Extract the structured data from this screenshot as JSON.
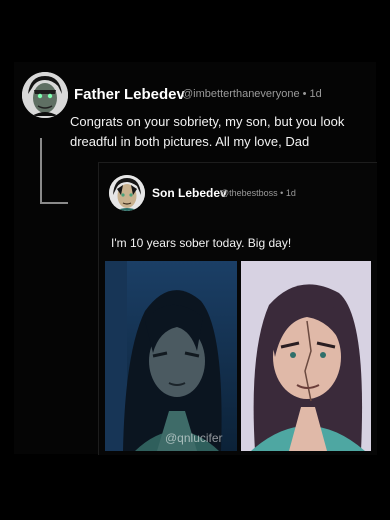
{
  "main_post": {
    "display_name": "Father Lebedev",
    "handle_meta": "@imbetterthaneveryone • 1d",
    "text": "Congrats on your sobriety, my son, but you look dreadful in both pictures.  All my love, Dad"
  },
  "quoted_post": {
    "display_name": "Son Lebedev",
    "handle_meta": "@thebestboss • 1d",
    "text": "I'm 10 years sober today. Big day!",
    "images": [
      {
        "watermark": "@qnlucifer"
      },
      {
        "watermark": ""
      }
    ]
  },
  "colors": {
    "background": "#000000",
    "text": "#f2f2f2",
    "meta": "#9a9a9a"
  }
}
